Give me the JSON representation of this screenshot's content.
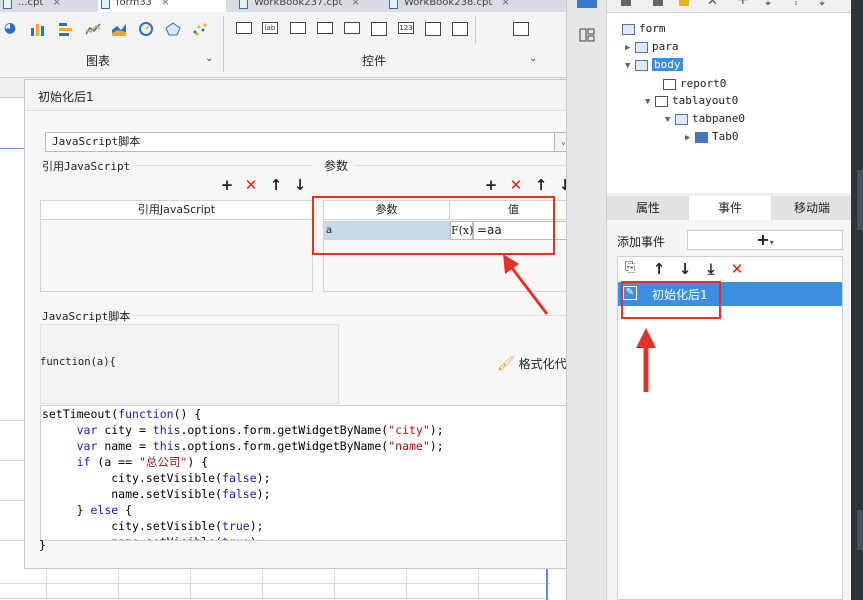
{
  "file_tabs": [
    {
      "label": "...cpt",
      "close": "×"
    },
    {
      "label": "form33",
      "close": "×"
    },
    {
      "label": "WorkBook237.cpt",
      "close": "×"
    },
    {
      "label": "WorkBook238.cpt",
      "close": "×"
    }
  ],
  "ribbon": {
    "chart_group_label": "图表",
    "widget_group_label": "控件",
    "chart_icons": [
      "pie-chart-icon",
      "bar-chart-icon",
      "column-chart-icon",
      "line-chart-icon",
      "area-chart-icon",
      "gauge-chart-icon",
      "radar-chart-icon",
      "scatter-chart-icon"
    ],
    "widget_icons": [
      "button-widget-icon",
      "label-widget-icon",
      "text-widget-icon",
      "combo-widget-icon",
      "checkbox-widget-icon",
      "table-widget-icon",
      "number-widget-icon",
      "textarea-widget-icon",
      "list-widget-icon",
      "search-widget-icon"
    ],
    "label_widget_text": "lab",
    "number_widget_text": "123"
  },
  "dialog": {
    "title": "初始化后1",
    "script_type": "JavaScript脚本",
    "ref_section_label": "引用JavaScript",
    "params_section_label": "参数",
    "ref_column_header": "引用JavaScript",
    "param_column_header": "参数",
    "value_column_header": "值",
    "param_rows": [
      {
        "name": "a",
        "formula_icon": "F(x)",
        "value": "=aa"
      }
    ],
    "script_section_label": "JavaScript脚本",
    "function_signature": "function(a){",
    "format_button": "格式化代码",
    "closing_brace": "}",
    "code_lines": [
      "setTimeout(function() {",
      "     var city = this.options.form.getWidgetByName(\"city\");",
      "     var name = this.options.form.getWidgetByName(\"name\");",
      "     if (a == \"总公司\") {",
      "          city.setVisible(false);",
      "          name.setVisible(false);",
      "     } else {",
      "          city.setVisible(true);",
      "          name.setVisible(true);"
    ]
  },
  "tree": {
    "root": "form",
    "items": [
      {
        "label": "para",
        "expander": "▶"
      },
      {
        "label": "body",
        "expander": "▼",
        "selected": true
      },
      {
        "label": "report0",
        "expander": ""
      },
      {
        "label": "tablayout0",
        "expander": "▼"
      },
      {
        "label": "tabpane0",
        "expander": "▼"
      },
      {
        "label": "Tab0",
        "expander": "▶"
      }
    ]
  },
  "property_tabs": [
    "属性",
    "事件",
    "移动端"
  ],
  "events": {
    "add_event_label": "添加事件",
    "add_symbol": "+",
    "event_list": [
      {
        "label": "初始化后1",
        "selected": true
      }
    ]
  },
  "colors": {
    "selection_blue": "#3c8fe0",
    "annotation_red": "#e5302a",
    "param_row_bg": "#c5d9ea"
  }
}
